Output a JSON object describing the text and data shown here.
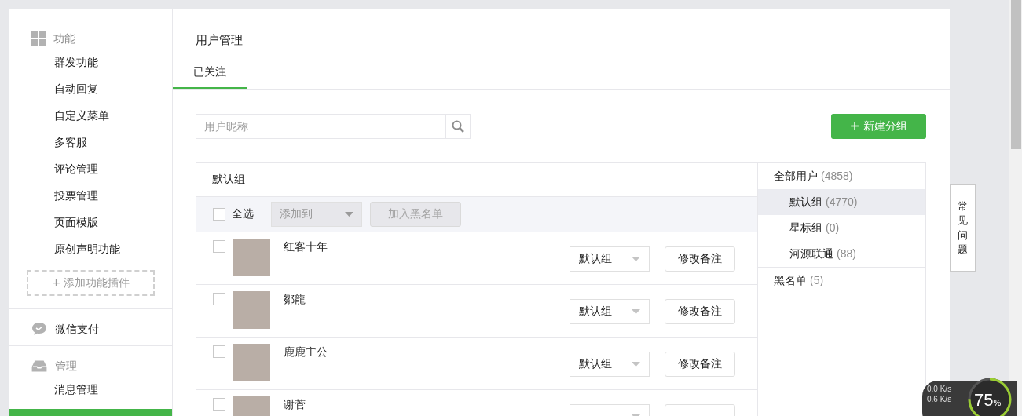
{
  "sidebar": {
    "sections": [
      {
        "title": "功能",
        "items": [
          {
            "label": "群发功能",
            "selected": false
          },
          {
            "label": "自动回复",
            "selected": false
          },
          {
            "label": "自定义菜单",
            "selected": false
          },
          {
            "label": "多客服",
            "selected": false
          },
          {
            "label": "评论管理",
            "selected": false
          },
          {
            "label": "投票管理",
            "selected": false
          },
          {
            "label": "页面模版",
            "selected": false
          },
          {
            "label": "原创声明功能",
            "selected": false
          }
        ],
        "add_button": {
          "icon": "+",
          "label": "添加功能插件"
        }
      },
      {
        "title": "微信支付"
      },
      {
        "title": "管理",
        "items": [
          {
            "label": "消息管理",
            "selected": false
          },
          {
            "selected": true
          }
        ]
      }
    ]
  },
  "page": {
    "title": "用户管理",
    "tabs": [
      {
        "label": "已关注",
        "selected": true
      }
    ]
  },
  "search": {
    "placeholder": "用户昵称"
  },
  "new_group_button": {
    "icon": "+",
    "label": "新建分组"
  },
  "user_table": {
    "group_title": "默认组",
    "select_all": {
      "label": "全选",
      "checked": false
    },
    "add_to": {
      "label": "添加到",
      "disabled": true
    },
    "blacklist_button": {
      "label": "加入黑名单",
      "disabled": true
    },
    "rows": [
      {
        "name": "红客十年",
        "checked": false,
        "group": "默认组",
        "remark_button": "修改备注"
      },
      {
        "name": "鄒龍",
        "checked": false,
        "group": "默认组",
        "remark_button": "修改备注"
      },
      {
        "name": "鹿鹿主公",
        "checked": false,
        "group": "默认组",
        "remark_button": "修改备注"
      },
      {
        "name": "谢菅",
        "checked": false
      }
    ]
  },
  "groups": [
    {
      "label": "全部用户",
      "count": "(4858)",
      "selected": false,
      "children": [
        {
          "label": "默认组",
          "count": "(4770)",
          "selected": true
        },
        {
          "label": "星标组",
          "count": "(0)",
          "selected": false
        },
        {
          "label": "河源联通",
          "count": "(88)",
          "selected": false
        }
      ]
    },
    {
      "label": "黑名单",
      "count": "(5)",
      "selected": false
    }
  ],
  "faq_tab": "常见问题",
  "speed_widget": {
    "upload": "0.0 K/s",
    "download": "0.6 K/s",
    "percent": "75",
    "unit": "%"
  }
}
